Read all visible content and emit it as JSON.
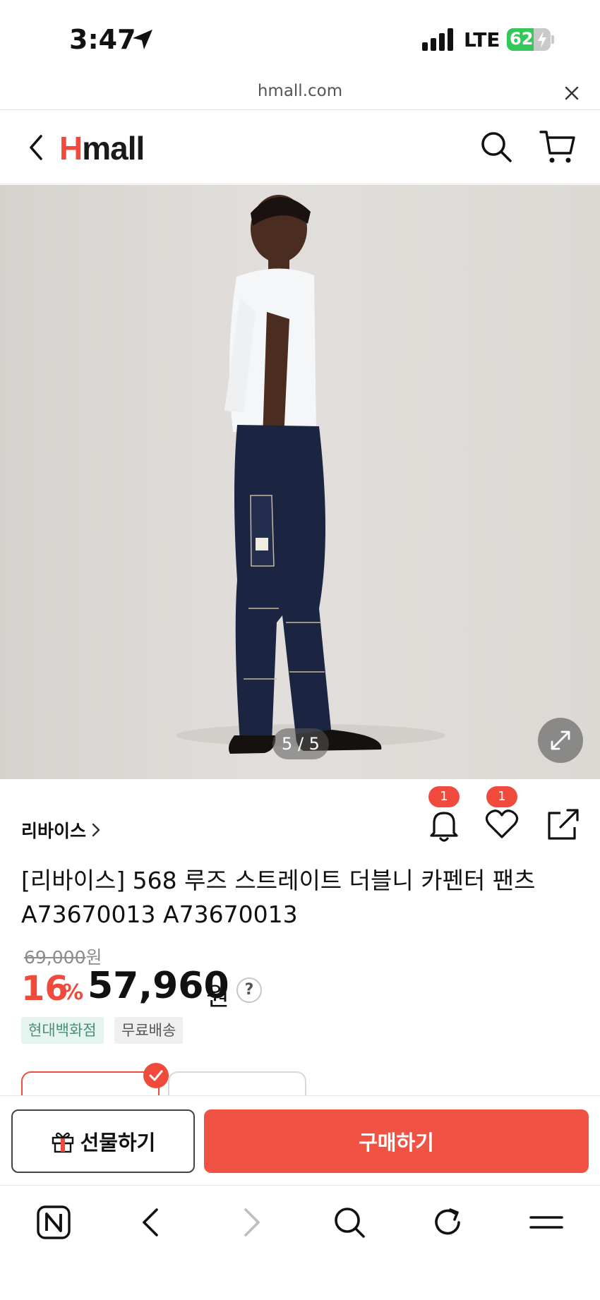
{
  "status_bar": {
    "time": "3:47",
    "network": "LTE",
    "battery_percent": "62",
    "battery_level": 0.62,
    "battery_color": "#34c759"
  },
  "url_bar": {
    "domain": "hmall.com"
  },
  "header": {
    "logo_h": "H",
    "logo_rest": "mall",
    "brand_color": "#ef4a3c"
  },
  "product": {
    "image_counter": "5 / 5",
    "brand": "리바이스",
    "title": "[리바이스] 568 루즈 스트레이트 더블니 카펜터 팬츠 A73670013 A73670013",
    "original_price": "69,000",
    "original_price_unit": "원",
    "discount_rate": "16",
    "discount_unit": "%",
    "sale_price": "57,960",
    "sale_price_unit": "원",
    "help_label": "?",
    "tags": [
      "현대백화점",
      "무료배송"
    ]
  },
  "actions": {
    "alert_count": "1",
    "like_count": "1"
  },
  "option_tabs": [
    "",
    ""
  ],
  "purchase_bar": {
    "gift_label": "선물하기",
    "buy_label": "구매하기",
    "buy_color": "#f05343"
  },
  "icons": [
    "location-arrow-icon",
    "signal-icon",
    "battery-icon",
    "close-icon",
    "back-arrow-icon",
    "search-icon",
    "cart-icon",
    "expand-icon",
    "chevron-right-icon",
    "bell-icon",
    "heart-icon",
    "share-icon",
    "check-icon",
    "gift-icon",
    "naver-icon",
    "browser-back-icon",
    "browser-forward-icon",
    "browser-search-icon",
    "refresh-icon",
    "menu-icon"
  ]
}
